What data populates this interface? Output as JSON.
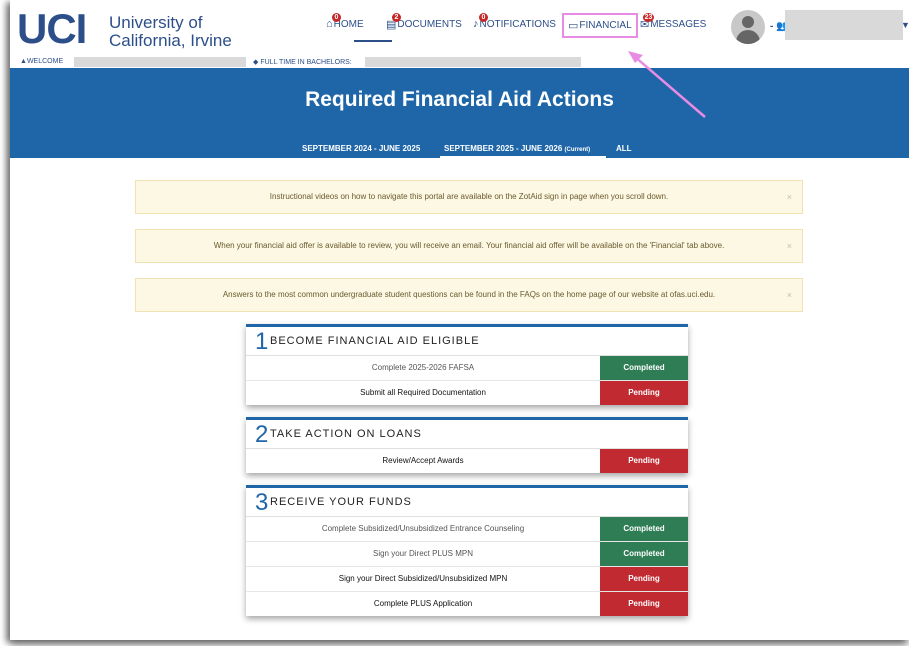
{
  "header": {
    "logo": "UCI",
    "university_line1": "University of",
    "university_line2": "California, Irvine",
    "nav": [
      {
        "label": "HOME",
        "badge": "0"
      },
      {
        "label": "DOCUMENTS",
        "badge": "2"
      },
      {
        "label": "NOTIFICATIONS",
        "badge": "0"
      },
      {
        "label": "FINANCIAL",
        "badge": ""
      },
      {
        "label": "MESSAGES",
        "badge": "23"
      }
    ],
    "user_prefix": "-"
  },
  "strip": {
    "welcome": "WELCOME",
    "program": "FULL TIME IN BACHELORS:"
  },
  "banner": {
    "title": "Required Financial Aid Actions",
    "terms": [
      "SEPTEMBER 2024 - JUNE 2025",
      "SEPTEMBER 2025 - JUNE 2026",
      "ALL"
    ],
    "current_tag": "(Current)"
  },
  "alerts": [
    "Instructional videos on how to navigate this portal are available on the ZotAid sign in page when you scroll down.",
    "When your financial aid offer is available to review, you will receive an email. Your financial aid offer will be available on the 'Financial' tab above.",
    "Answers to the most common undergraduate student questions can be found in the FAQs on the home page of our website at ofas.uci.edu."
  ],
  "close_glyph": "×",
  "cards": [
    {
      "num": "1",
      "title": "BECOME FINANCIAL AID ELIGIBLE",
      "rows": [
        {
          "label": "Complete 2025-2026 FAFSA",
          "status": "Completed"
        },
        {
          "label": "Submit all Required Documentation",
          "status": "Pending"
        }
      ]
    },
    {
      "num": "2",
      "title": "TAKE ACTION ON LOANS",
      "rows": [
        {
          "label": "Review/Accept Awards",
          "status": "Pending"
        }
      ]
    },
    {
      "num": "3",
      "title": "RECEIVE YOUR FUNDS",
      "rows": [
        {
          "label": "Complete Subsidized/Unsubsidized Entrance Counseling",
          "status": "Completed"
        },
        {
          "label": "Sign your Direct PLUS MPN",
          "status": "Completed"
        },
        {
          "label": "Sign your Direct Subsidized/Unsubsidized MPN",
          "status": "Pending"
        },
        {
          "label": "Complete PLUS Application",
          "status": "Pending"
        }
      ]
    }
  ],
  "colors": {
    "brand": "#2c4f8a",
    "banner": "#1f66a8",
    "completed": "#2e7d55",
    "pending": "#c02a30",
    "highlight": "#e88be4"
  }
}
